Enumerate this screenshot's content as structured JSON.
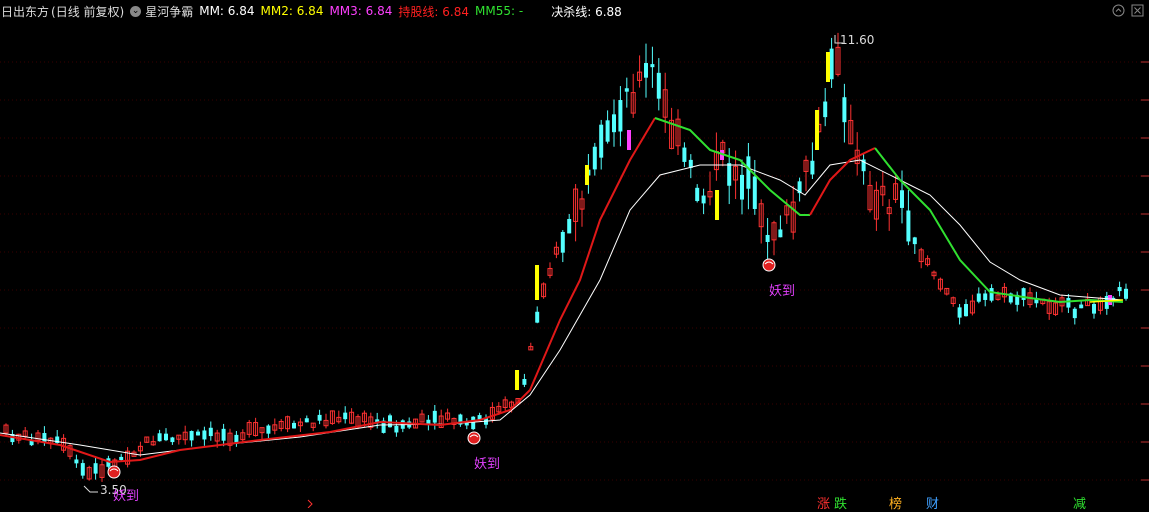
{
  "header": {
    "stock": "日出东方",
    "period": "(日线 前复权)",
    "indicator": "星河争霸",
    "mm_label": "MM:",
    "mm_value": "6.84",
    "mm2_label": "MM2:",
    "mm2_value": "6.84",
    "mm3_label": "MM3:",
    "mm3_value": "6.84",
    "hold_label": "持股线:",
    "hold_value": "6.84",
    "mm55_label": "MM55:",
    "mm55_value": "-",
    "kill_label": "决杀线:",
    "kill_value": "6.88"
  },
  "colors": {
    "up": "#ff3232",
    "down": "#54ffff",
    "bg": "#000000",
    "hold_line": "#e01818",
    "green_line": "#30e030",
    "white_line": "#ffffff",
    "yellow": "#ffff00",
    "magenta": "#ff40ff"
  },
  "chart_data": {
    "type": "candlestick",
    "max_label": "11.60",
    "min_label": "3.50",
    "signal_label": "妖到",
    "bottom_tags": [
      "涨",
      "跌",
      "榜",
      "财",
      "减"
    ]
  }
}
